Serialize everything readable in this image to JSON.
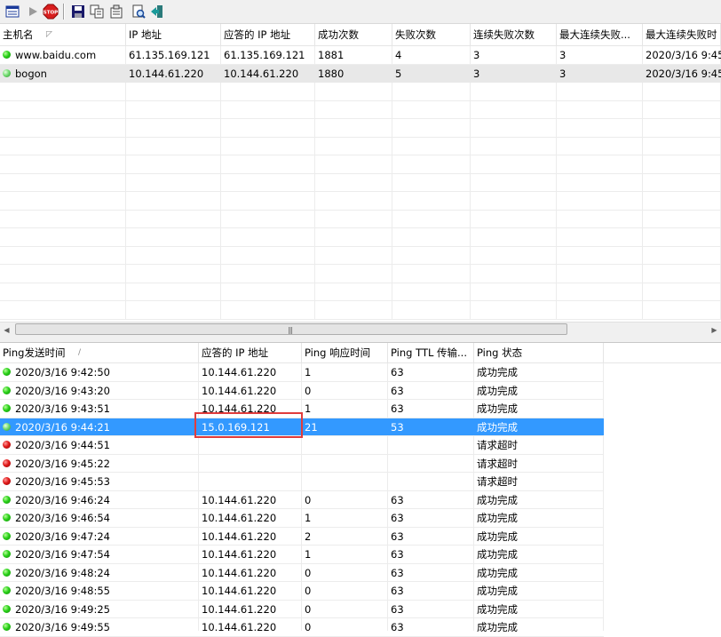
{
  "toolbar": {
    "buttons": [
      {
        "name": "properties-icon"
      },
      {
        "name": "play-icon"
      },
      {
        "name": "stop-icon",
        "label": "STOP"
      },
      {
        "name": "save-icon"
      },
      {
        "name": "copy-icon"
      },
      {
        "name": "options-icon"
      },
      {
        "name": "find-icon"
      },
      {
        "name": "exit-icon"
      }
    ]
  },
  "hosts": {
    "columns": [
      "主机名",
      "IP 地址",
      "应答的 IP 地址",
      "成功次数",
      "失败次数",
      "连续失败次数",
      "最大连续失败...",
      "最大连续失败时"
    ],
    "rows": [
      {
        "status": "green",
        "host": "www.baidu.com",
        "ip": "61.135.169.121",
        "reply_ip": "61.135.169.121",
        "success": "1881",
        "fail": "4",
        "consecutive_fail": "3",
        "max_consecutive_fail": "3",
        "max_fail_time": "2020/3/16 9:45"
      },
      {
        "status": "lightgreen",
        "host": "bogon",
        "ip": "10.144.61.220",
        "reply_ip": "10.144.61.220",
        "success": "1880",
        "fail": "5",
        "consecutive_fail": "3",
        "max_consecutive_fail": "3",
        "max_fail_time": "2020/3/16 9:45"
      }
    ]
  },
  "pings": {
    "columns": [
      "Ping发送时间",
      "应答的 IP 地址",
      "Ping 响应时间",
      "Ping TTL 传输...",
      "Ping 状态"
    ],
    "rows": [
      {
        "status": "green",
        "time": "2020/3/16 9:42:50",
        "reply_ip": "10.144.61.220",
        "rtt": "1",
        "ttl": "63",
        "state": "成功完成"
      },
      {
        "status": "green",
        "time": "2020/3/16 9:43:20",
        "reply_ip": "10.144.61.220",
        "rtt": "0",
        "ttl": "63",
        "state": "成功完成"
      },
      {
        "status": "green",
        "time": "2020/3/16 9:43:51",
        "reply_ip": "10.144.61.220",
        "rtt": "1",
        "ttl": "63",
        "state": "成功完成"
      },
      {
        "status": "lightgreen",
        "time": "2020/3/16 9:44:21",
        "reply_ip": "15.0.169.121",
        "rtt": "21",
        "ttl": "53",
        "state": "成功完成",
        "selected": true
      },
      {
        "status": "red",
        "time": "2020/3/16 9:44:51",
        "reply_ip": "",
        "rtt": "",
        "ttl": "",
        "state": "请求超时"
      },
      {
        "status": "red",
        "time": "2020/3/16 9:45:22",
        "reply_ip": "",
        "rtt": "",
        "ttl": "",
        "state": "请求超时"
      },
      {
        "status": "red",
        "time": "2020/3/16 9:45:53",
        "reply_ip": "",
        "rtt": "",
        "ttl": "",
        "state": "请求超时"
      },
      {
        "status": "green",
        "time": "2020/3/16 9:46:24",
        "reply_ip": "10.144.61.220",
        "rtt": "0",
        "ttl": "63",
        "state": "成功完成"
      },
      {
        "status": "green",
        "time": "2020/3/16 9:46:54",
        "reply_ip": "10.144.61.220",
        "rtt": "1",
        "ttl": "63",
        "state": "成功完成"
      },
      {
        "status": "green",
        "time": "2020/3/16 9:47:24",
        "reply_ip": "10.144.61.220",
        "rtt": "2",
        "ttl": "63",
        "state": "成功完成"
      },
      {
        "status": "green",
        "time": "2020/3/16 9:47:54",
        "reply_ip": "10.144.61.220",
        "rtt": "1",
        "ttl": "63",
        "state": "成功完成"
      },
      {
        "status": "green",
        "time": "2020/3/16 9:48:24",
        "reply_ip": "10.144.61.220",
        "rtt": "0",
        "ttl": "63",
        "state": "成功完成"
      },
      {
        "status": "green",
        "time": "2020/3/16 9:48:55",
        "reply_ip": "10.144.61.220",
        "rtt": "0",
        "ttl": "63",
        "state": "成功完成"
      },
      {
        "status": "green",
        "time": "2020/3/16 9:49:25",
        "reply_ip": "10.144.61.220",
        "rtt": "0",
        "ttl": "63",
        "state": "成功完成"
      },
      {
        "status": "green",
        "time": "2020/3/16 9:49:55",
        "reply_ip": "10.144.61.220",
        "rtt": "0",
        "ttl": "63",
        "state": "成功完成"
      }
    ]
  },
  "colors": {
    "selection": "#3399ff",
    "highlight_box": "#e03c3c",
    "ok": "#28d018",
    "timeout": "#e01818"
  }
}
